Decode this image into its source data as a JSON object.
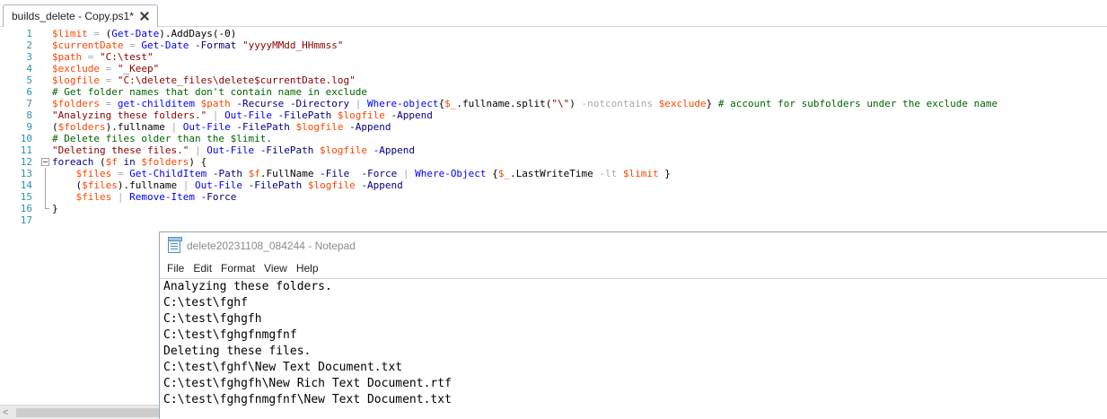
{
  "ise": {
    "tab_title": "builds_delete - Copy.ps1*",
    "line_numbers": [
      "1",
      "2",
      "3",
      "4",
      "5",
      "6",
      "7",
      "8",
      "9",
      "10",
      "11",
      "12",
      "13",
      "14",
      "15",
      "16",
      "17"
    ],
    "code": [
      [
        [
          "var",
          "$limit"
        ],
        [
          "op",
          " = "
        ],
        [
          "pl",
          "("
        ],
        [
          "cmd",
          "Get-Date"
        ],
        [
          "pl",
          ")."
        ],
        [
          "mem",
          "AddDays"
        ],
        [
          "pl",
          "(-0)"
        ]
      ],
      [
        [
          "var",
          "$currentDate"
        ],
        [
          "op",
          " = "
        ],
        [
          "cmd",
          "Get-Date"
        ],
        [
          "pl",
          " "
        ],
        [
          "par",
          "-Format"
        ],
        [
          "pl",
          " "
        ],
        [
          "str",
          "\"yyyyMMdd_HHmmss\""
        ]
      ],
      [
        [
          "var",
          "$path"
        ],
        [
          "op",
          " = "
        ],
        [
          "str",
          "\"C:\\test\""
        ]
      ],
      [
        [
          "var",
          "$exclude"
        ],
        [
          "op",
          " = "
        ],
        [
          "str",
          "\"_Keep\""
        ]
      ],
      [
        [
          "var",
          "$logfile"
        ],
        [
          "op",
          " = "
        ],
        [
          "str",
          "\"C:\\delete_files\\delete$currentDate.log\""
        ]
      ],
      [
        [
          "cmt",
          "# Get folder names that don't contain name in exclude"
        ]
      ],
      [
        [
          "var",
          "$folders"
        ],
        [
          "op",
          " = "
        ],
        [
          "cmd",
          "get-childitem"
        ],
        [
          "pl",
          " "
        ],
        [
          "var",
          "$path"
        ],
        [
          "pl",
          " "
        ],
        [
          "par",
          "-Recurse"
        ],
        [
          "pl",
          " "
        ],
        [
          "par",
          "-Directory"
        ],
        [
          "op",
          " | "
        ],
        [
          "cmd",
          "Where-object"
        ],
        [
          "pl",
          "{"
        ],
        [
          "var",
          "$_"
        ],
        [
          "pl",
          "."
        ],
        [
          "mem",
          "fullname"
        ],
        [
          "pl",
          "."
        ],
        [
          "mem",
          "split"
        ],
        [
          "pl",
          "("
        ],
        [
          "str",
          "\"\\\""
        ],
        [
          "pl",
          ") "
        ],
        [
          "op",
          "-notcontains"
        ],
        [
          "pl",
          " "
        ],
        [
          "var",
          "$exclude"
        ],
        [
          "pl",
          "} "
        ],
        [
          "cmt",
          "# account for subfolders under the exclude name"
        ]
      ],
      [
        [
          "str",
          "\"Analyzing these folders.\""
        ],
        [
          "op",
          " | "
        ],
        [
          "cmd",
          "Out-File"
        ],
        [
          "pl",
          " "
        ],
        [
          "par",
          "-FilePath"
        ],
        [
          "pl",
          " "
        ],
        [
          "var",
          "$logfile"
        ],
        [
          "pl",
          " "
        ],
        [
          "par",
          "-Append"
        ]
      ],
      [
        [
          "pl",
          "("
        ],
        [
          "var",
          "$folders"
        ],
        [
          "pl",
          ")."
        ],
        [
          "mem",
          "fullname"
        ],
        [
          "op",
          " | "
        ],
        [
          "cmd",
          "Out-File"
        ],
        [
          "pl",
          " "
        ],
        [
          "par",
          "-FilePath"
        ],
        [
          "pl",
          " "
        ],
        [
          "var",
          "$logfile"
        ],
        [
          "pl",
          " "
        ],
        [
          "par",
          "-Append"
        ]
      ],
      [
        [
          "cmt",
          "# Delete files older than the $limit."
        ]
      ],
      [
        [
          "str",
          "\"Deleting these files.\""
        ],
        [
          "op",
          " | "
        ],
        [
          "cmd",
          "Out-File"
        ],
        [
          "pl",
          " "
        ],
        [
          "par",
          "-FilePath"
        ],
        [
          "pl",
          " "
        ],
        [
          "var",
          "$logfile"
        ],
        [
          "pl",
          " "
        ],
        [
          "par",
          "-Append"
        ]
      ],
      [
        [
          "kw",
          "foreach"
        ],
        [
          "pl",
          " ("
        ],
        [
          "var",
          "$f"
        ],
        [
          "pl",
          " "
        ],
        [
          "kw",
          "in"
        ],
        [
          "pl",
          " "
        ],
        [
          "var",
          "$folders"
        ],
        [
          "pl",
          ") {"
        ]
      ],
      [
        [
          "pl",
          "    "
        ],
        [
          "var",
          "$files"
        ],
        [
          "op",
          " = "
        ],
        [
          "cmd",
          "Get-ChildItem"
        ],
        [
          "pl",
          " "
        ],
        [
          "par",
          "-Path"
        ],
        [
          "pl",
          " "
        ],
        [
          "var",
          "$f"
        ],
        [
          "pl",
          "."
        ],
        [
          "mem",
          "FullName"
        ],
        [
          "pl",
          " "
        ],
        [
          "par",
          "-File"
        ],
        [
          "pl",
          "  "
        ],
        [
          "par",
          "-Force"
        ],
        [
          "op",
          " | "
        ],
        [
          "cmd",
          "Where-Object"
        ],
        [
          "pl",
          " {"
        ],
        [
          "var",
          "$_"
        ],
        [
          "pl",
          "."
        ],
        [
          "mem",
          "LastWriteTime"
        ],
        [
          "pl",
          " "
        ],
        [
          "op",
          "-lt"
        ],
        [
          "pl",
          " "
        ],
        [
          "var",
          "$limit"
        ],
        [
          "pl",
          " }"
        ]
      ],
      [
        [
          "pl",
          "    ("
        ],
        [
          "var",
          "$files"
        ],
        [
          "pl",
          ")."
        ],
        [
          "mem",
          "fullname"
        ],
        [
          "op",
          " | "
        ],
        [
          "cmd",
          "Out-File"
        ],
        [
          "pl",
          " "
        ],
        [
          "par",
          "-FilePath"
        ],
        [
          "pl",
          " "
        ],
        [
          "var",
          "$logfile"
        ],
        [
          "pl",
          " "
        ],
        [
          "par",
          "-Append"
        ]
      ],
      [
        [
          "pl",
          "    "
        ],
        [
          "var",
          "$files"
        ],
        [
          "op",
          " | "
        ],
        [
          "cmd",
          "Remove-Item"
        ],
        [
          "pl",
          " "
        ],
        [
          "par",
          "-Force"
        ]
      ],
      [
        [
          "pl",
          "}"
        ]
      ],
      []
    ],
    "fold": [
      "",
      "",
      "",
      "",
      "",
      "",
      "",
      "",
      "",
      "",
      "",
      "box",
      "line",
      "line",
      "line",
      "end",
      ""
    ]
  },
  "notepad": {
    "title": "delete20231108_084244 - Notepad",
    "menu": [
      "File",
      "Edit",
      "Format",
      "View",
      "Help"
    ],
    "lines": [
      "Analyzing these folders.",
      "C:\\test\\fghf",
      "C:\\test\\fghgfh",
      "C:\\test\\fghgfnmgfnf",
      "Deleting these files.",
      "C:\\test\\fghf\\New Text Document.txt",
      "C:\\test\\fghgfh\\New Rich Text Document.rtf",
      "C:\\test\\fghgfnmgfnf\\New Text Document.txt"
    ]
  },
  "colors": {
    "variable": "#ff4500",
    "command": "#0000ff",
    "parameter": "#000080",
    "string": "#8b0000",
    "comment": "#006400",
    "keyword": "#00008b",
    "line_number": "#2b91af"
  }
}
